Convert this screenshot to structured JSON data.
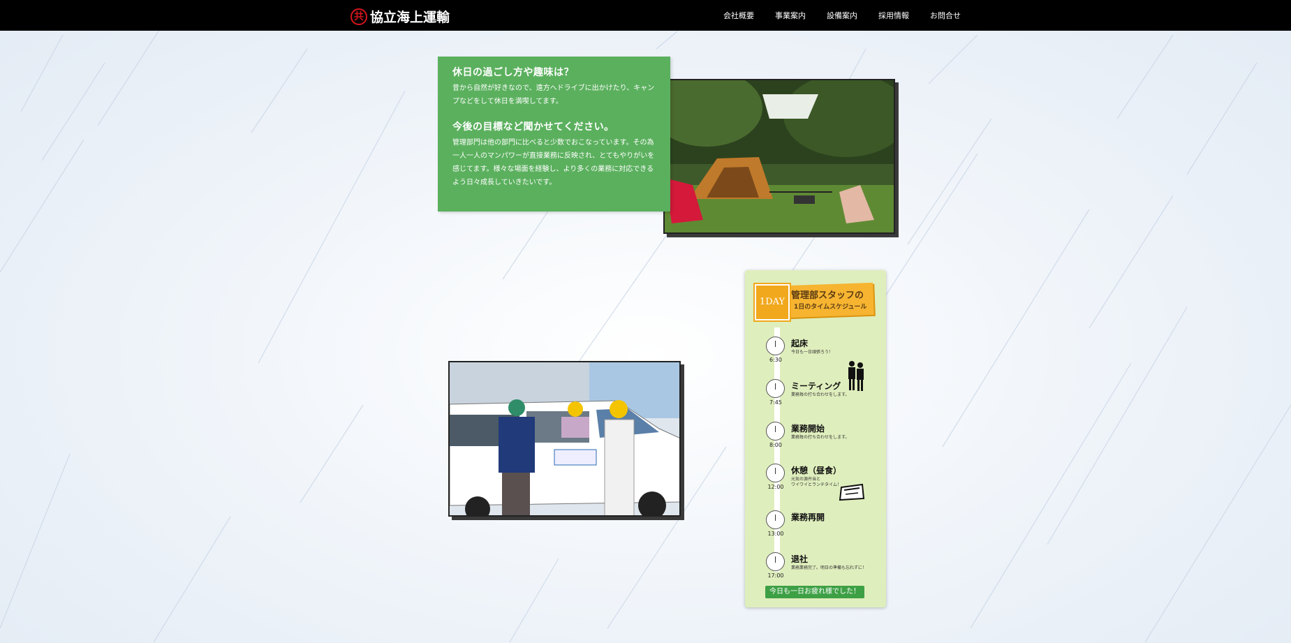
{
  "header": {
    "logo_mark": "共",
    "logo_text": "協立海上運輸",
    "nav": [
      "会社概要",
      "事業案内",
      "設備案内",
      "採用情報",
      "お問合せ"
    ]
  },
  "qa": {
    "q1": "休日の過ごし方や趣味は？",
    "a1": "昔から自然が好きなので、遠方へドライブに出かけたり、キャンプなどをして休日を満喫してます。",
    "q2": "今後の目標など聞かせてください。",
    "a2": "管理部門は他の部門に比べると少数でおこなっています。その為一人一人のマンパワーが直接業務に反映され、とてもやりがいを感じてます。様々な場面を経験し、より多くの業務に対応できるよう日々成長していきたいです。"
  },
  "schedule": {
    "badge": "1DAY",
    "title1": "管理部スタッフの",
    "title2": "1日のタイムスケジュール",
    "items": [
      {
        "time": "6:30",
        "title": "起床",
        "sub": "今日も一日頑張ろう！"
      },
      {
        "time": "7:45",
        "title": "ミーティング",
        "sub": "業務毎の打ち合わせをします。"
      },
      {
        "time": "8:00",
        "title": "業務開始",
        "sub": "業務毎の打ち合わせをします。"
      },
      {
        "time": "12:00",
        "title": "休憩（昼食）",
        "sub": "元気の源弁当と\nワイワイとランチタイム！"
      },
      {
        "time": "13:00",
        "title": "業務再開",
        "sub": ""
      },
      {
        "time": "17:00",
        "title": "退社",
        "sub": "業務業務完了。明日の準備も忘れずに！"
      }
    ],
    "done_label": "今日も一日お疲れ様でした！"
  },
  "colors": {
    "header_bg": "#000000",
    "qa_green": "#5bb05e",
    "schedule_bg": "#dfeebd",
    "badge_orange": "#f1a81d",
    "button_green": "#3ea045",
    "logo_red": "#d4161d"
  }
}
